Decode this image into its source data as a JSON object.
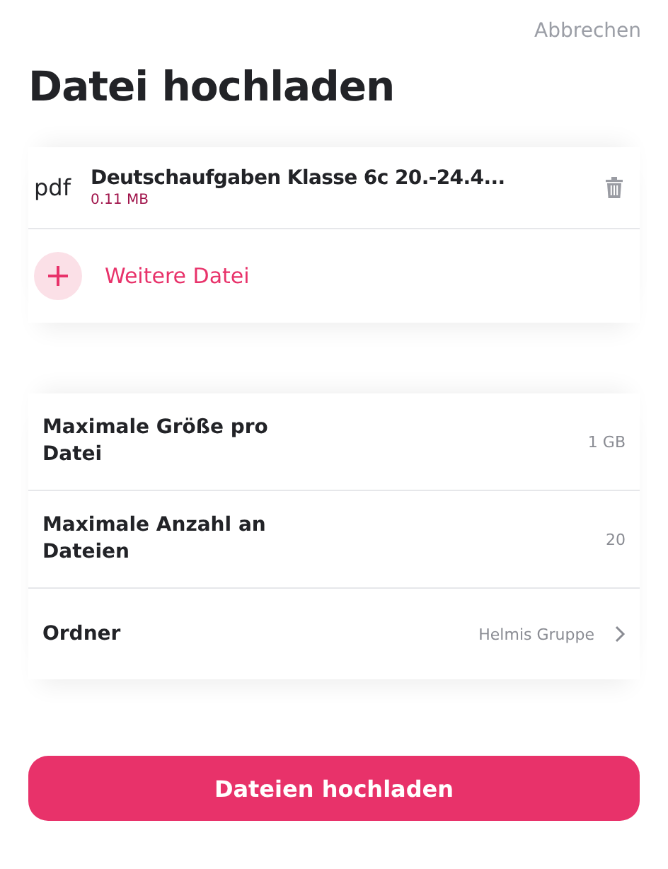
{
  "cancel": "Abbrechen",
  "title": "Datei hochladen",
  "files": [
    {
      "type": "pdf",
      "name": "Deutschaufgaben Klasse 6c 20.-24.4...",
      "size": "0.11 MB"
    }
  ],
  "add_file": "Weitere Datei",
  "settings": [
    {
      "kind": "value",
      "label": "Maximale Größe pro Datei",
      "value": "1 GB"
    },
    {
      "kind": "value",
      "label": "Maximale Anzahl an Dateien",
      "value": "20"
    },
    {
      "kind": "link",
      "label": "Ordner",
      "value": "Helmis Gruppe"
    }
  ],
  "submit": "Dateien hochladen"
}
